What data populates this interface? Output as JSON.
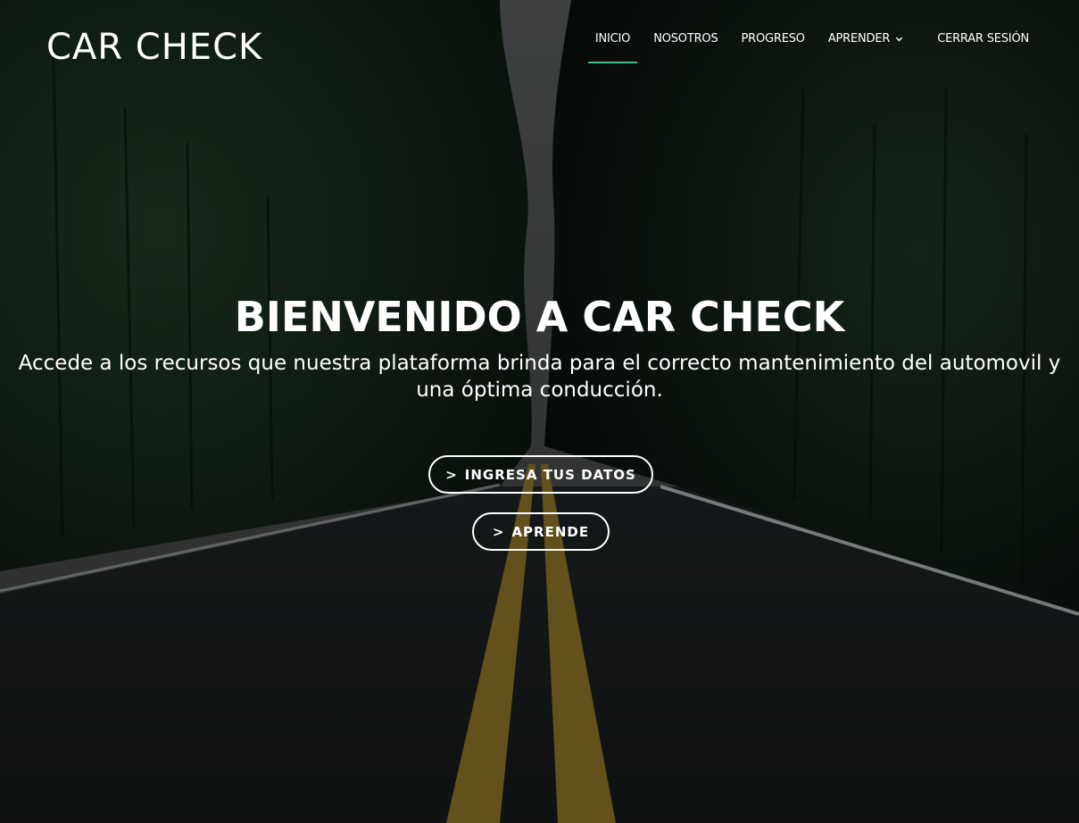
{
  "brand": {
    "logo_text": "CAR CHECK"
  },
  "nav": {
    "items": [
      {
        "label": "INICIO",
        "active": true
      },
      {
        "label": "NOSOTROS"
      },
      {
        "label": "PROGRESO"
      },
      {
        "label": "APRENDER",
        "has_dropdown": true,
        "icon": "chevron-down-icon"
      },
      {
        "label": "CERRAR SESIÓN"
      }
    ],
    "active_color": "#3fbf8f"
  },
  "hero": {
    "title": "BIENVENIDO A CAR CHECK",
    "subtitle": "Accede a los recursos que nuestra plataforma brinda para el correcto mantenimiento del automovil y una óptima conducción.",
    "buttons": [
      {
        "prefix": ">",
        "label": "INGRESA TUS DATOS"
      },
      {
        "prefix": ">",
        "label": "APRENDE"
      }
    ]
  }
}
